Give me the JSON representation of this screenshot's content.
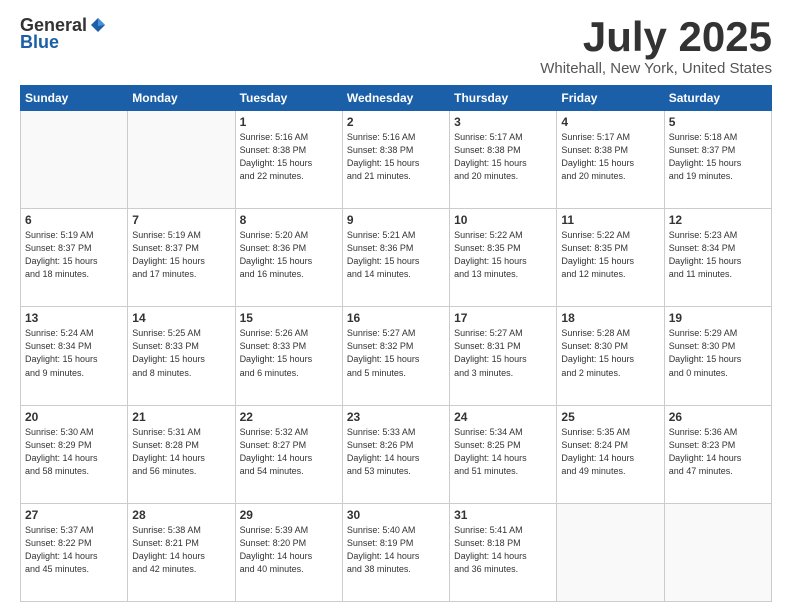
{
  "logo": {
    "general": "General",
    "blue": "Blue"
  },
  "header": {
    "title": "July 2025",
    "subtitle": "Whitehall, New York, United States"
  },
  "weekdays": [
    "Sunday",
    "Monday",
    "Tuesday",
    "Wednesday",
    "Thursday",
    "Friday",
    "Saturday"
  ],
  "weeks": [
    [
      {
        "day": "",
        "info": ""
      },
      {
        "day": "",
        "info": ""
      },
      {
        "day": "1",
        "info": "Sunrise: 5:16 AM\nSunset: 8:38 PM\nDaylight: 15 hours\nand 22 minutes."
      },
      {
        "day": "2",
        "info": "Sunrise: 5:16 AM\nSunset: 8:38 PM\nDaylight: 15 hours\nand 21 minutes."
      },
      {
        "day": "3",
        "info": "Sunrise: 5:17 AM\nSunset: 8:38 PM\nDaylight: 15 hours\nand 20 minutes."
      },
      {
        "day": "4",
        "info": "Sunrise: 5:17 AM\nSunset: 8:38 PM\nDaylight: 15 hours\nand 20 minutes."
      },
      {
        "day": "5",
        "info": "Sunrise: 5:18 AM\nSunset: 8:37 PM\nDaylight: 15 hours\nand 19 minutes."
      }
    ],
    [
      {
        "day": "6",
        "info": "Sunrise: 5:19 AM\nSunset: 8:37 PM\nDaylight: 15 hours\nand 18 minutes."
      },
      {
        "day": "7",
        "info": "Sunrise: 5:19 AM\nSunset: 8:37 PM\nDaylight: 15 hours\nand 17 minutes."
      },
      {
        "day": "8",
        "info": "Sunrise: 5:20 AM\nSunset: 8:36 PM\nDaylight: 15 hours\nand 16 minutes."
      },
      {
        "day": "9",
        "info": "Sunrise: 5:21 AM\nSunset: 8:36 PM\nDaylight: 15 hours\nand 14 minutes."
      },
      {
        "day": "10",
        "info": "Sunrise: 5:22 AM\nSunset: 8:35 PM\nDaylight: 15 hours\nand 13 minutes."
      },
      {
        "day": "11",
        "info": "Sunrise: 5:22 AM\nSunset: 8:35 PM\nDaylight: 15 hours\nand 12 minutes."
      },
      {
        "day": "12",
        "info": "Sunrise: 5:23 AM\nSunset: 8:34 PM\nDaylight: 15 hours\nand 11 minutes."
      }
    ],
    [
      {
        "day": "13",
        "info": "Sunrise: 5:24 AM\nSunset: 8:34 PM\nDaylight: 15 hours\nand 9 minutes."
      },
      {
        "day": "14",
        "info": "Sunrise: 5:25 AM\nSunset: 8:33 PM\nDaylight: 15 hours\nand 8 minutes."
      },
      {
        "day": "15",
        "info": "Sunrise: 5:26 AM\nSunset: 8:33 PM\nDaylight: 15 hours\nand 6 minutes."
      },
      {
        "day": "16",
        "info": "Sunrise: 5:27 AM\nSunset: 8:32 PM\nDaylight: 15 hours\nand 5 minutes."
      },
      {
        "day": "17",
        "info": "Sunrise: 5:27 AM\nSunset: 8:31 PM\nDaylight: 15 hours\nand 3 minutes."
      },
      {
        "day": "18",
        "info": "Sunrise: 5:28 AM\nSunset: 8:30 PM\nDaylight: 15 hours\nand 2 minutes."
      },
      {
        "day": "19",
        "info": "Sunrise: 5:29 AM\nSunset: 8:30 PM\nDaylight: 15 hours\nand 0 minutes."
      }
    ],
    [
      {
        "day": "20",
        "info": "Sunrise: 5:30 AM\nSunset: 8:29 PM\nDaylight: 14 hours\nand 58 minutes."
      },
      {
        "day": "21",
        "info": "Sunrise: 5:31 AM\nSunset: 8:28 PM\nDaylight: 14 hours\nand 56 minutes."
      },
      {
        "day": "22",
        "info": "Sunrise: 5:32 AM\nSunset: 8:27 PM\nDaylight: 14 hours\nand 54 minutes."
      },
      {
        "day": "23",
        "info": "Sunrise: 5:33 AM\nSunset: 8:26 PM\nDaylight: 14 hours\nand 53 minutes."
      },
      {
        "day": "24",
        "info": "Sunrise: 5:34 AM\nSunset: 8:25 PM\nDaylight: 14 hours\nand 51 minutes."
      },
      {
        "day": "25",
        "info": "Sunrise: 5:35 AM\nSunset: 8:24 PM\nDaylight: 14 hours\nand 49 minutes."
      },
      {
        "day": "26",
        "info": "Sunrise: 5:36 AM\nSunset: 8:23 PM\nDaylight: 14 hours\nand 47 minutes."
      }
    ],
    [
      {
        "day": "27",
        "info": "Sunrise: 5:37 AM\nSunset: 8:22 PM\nDaylight: 14 hours\nand 45 minutes."
      },
      {
        "day": "28",
        "info": "Sunrise: 5:38 AM\nSunset: 8:21 PM\nDaylight: 14 hours\nand 42 minutes."
      },
      {
        "day": "29",
        "info": "Sunrise: 5:39 AM\nSunset: 8:20 PM\nDaylight: 14 hours\nand 40 minutes."
      },
      {
        "day": "30",
        "info": "Sunrise: 5:40 AM\nSunset: 8:19 PM\nDaylight: 14 hours\nand 38 minutes."
      },
      {
        "day": "31",
        "info": "Sunrise: 5:41 AM\nSunset: 8:18 PM\nDaylight: 14 hours\nand 36 minutes."
      },
      {
        "day": "",
        "info": ""
      },
      {
        "day": "",
        "info": ""
      }
    ]
  ]
}
